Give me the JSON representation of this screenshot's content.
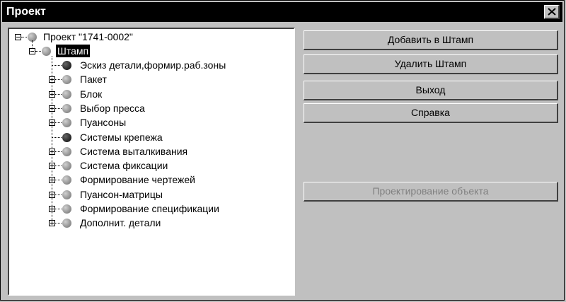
{
  "window": {
    "title": "Проект",
    "close_label": "✕"
  },
  "tree": {
    "root": "Проект \"1741-0002\"",
    "selected": "Штамп",
    "children": [
      {
        "label": "Эскиз детали,формир.раб.зоны",
        "icon": "dark",
        "expandable": false
      },
      {
        "label": "Пакет",
        "icon": "gray",
        "expandable": true
      },
      {
        "label": "Блок",
        "icon": "gray",
        "expandable": true
      },
      {
        "label": "Выбор пресса",
        "icon": "gray",
        "expandable": true
      },
      {
        "label": "Пуансоны",
        "icon": "gray",
        "expandable": true
      },
      {
        "label": "Системы крепежа",
        "icon": "dark",
        "expandable": false
      },
      {
        "label": "Система выталкивания",
        "icon": "gray",
        "expandable": true
      },
      {
        "label": "Система фиксации",
        "icon": "gray",
        "expandable": true
      },
      {
        "label": "Формирование чертежей",
        "icon": "gray",
        "expandable": true
      },
      {
        "label": "Пуансон-матрицы",
        "icon": "gray",
        "expandable": true
      },
      {
        "label": "Формирование спецификации",
        "icon": "gray",
        "expandable": true
      },
      {
        "label": "Дополнит. детали",
        "icon": "gray",
        "expandable": true
      }
    ]
  },
  "buttons": {
    "add": "Добавить в Штамп",
    "remove": "Удалить Штамп",
    "exit": "Выход",
    "help": "Справка",
    "design": "Проектирование объекта"
  }
}
